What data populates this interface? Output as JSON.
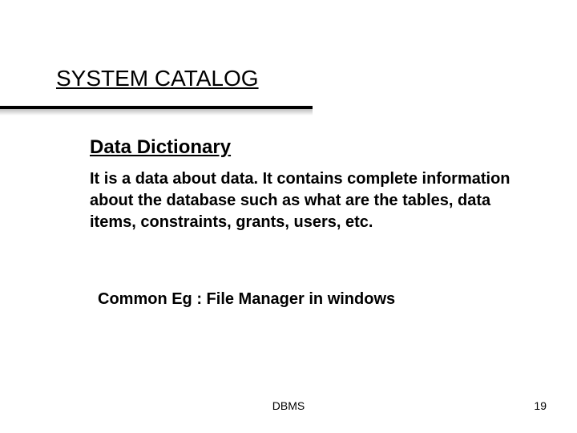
{
  "title": "SYSTEM CATALOG",
  "subheading": "Data Dictionary",
  "body": "It is a data about data. It contains complete information about the database such as what are the tables, data items, constraints, grants, users, etc.",
  "example": "Common Eg : File Manager in windows",
  "footer_center": "DBMS",
  "footer_right": "19"
}
